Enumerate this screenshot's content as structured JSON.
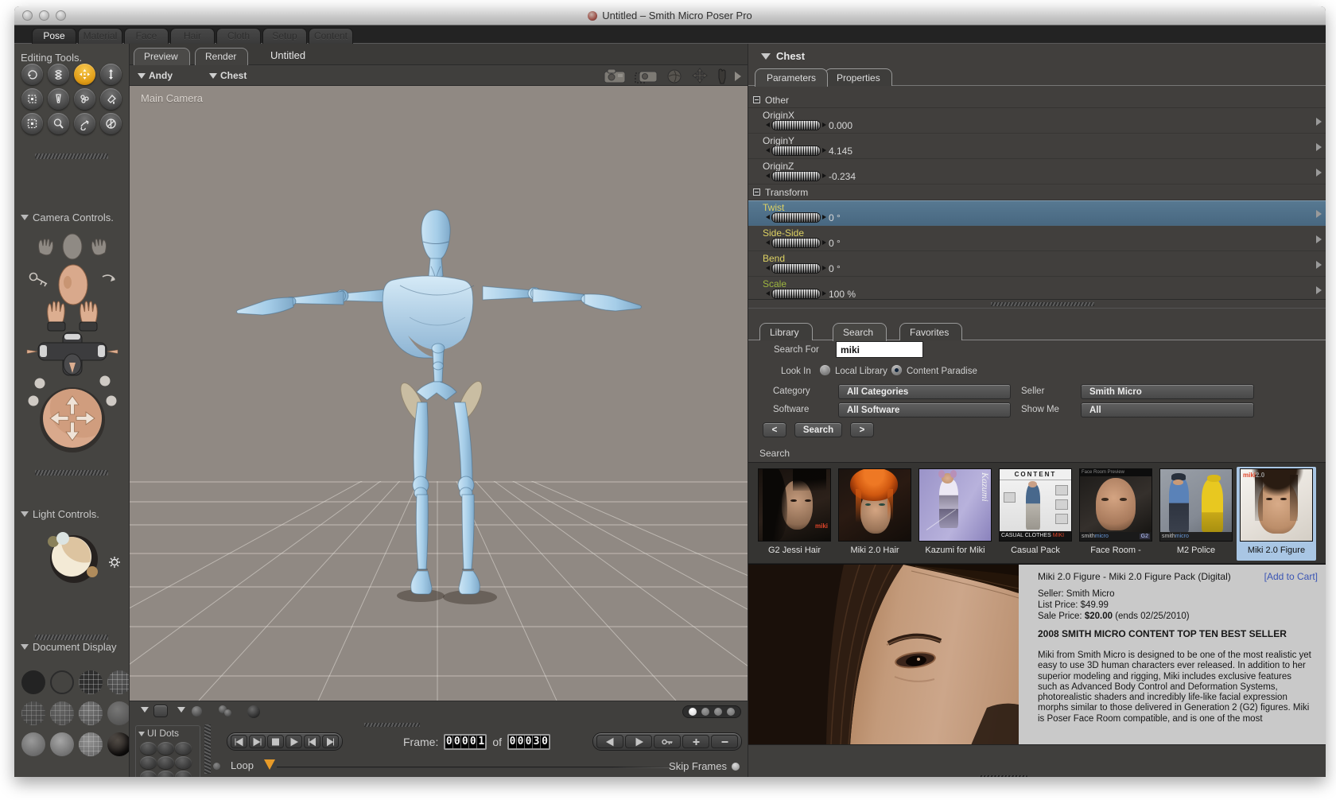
{
  "colors": {
    "accent_orange": "#e8a21f",
    "selection_blue": "#587c96",
    "thumb_selection": "#a9c6e4",
    "viewport_bg": "#908983"
  },
  "window": {
    "title": "Untitled – Smith Micro Poser Pro"
  },
  "main_tabs": {
    "items": [
      "Pose",
      "Material",
      "Face",
      "Hair",
      "Cloth",
      "Setup",
      "Content"
    ],
    "active": "Pose"
  },
  "sidebar": {
    "editing_tools": {
      "label": "Editing Tools.",
      "tools": [
        {
          "name": "rotate",
          "active": false
        },
        {
          "name": "twist",
          "active": false
        },
        {
          "name": "translate",
          "active": true
        },
        {
          "name": "translate-in-out",
          "active": false
        },
        {
          "name": "scale",
          "active": false
        },
        {
          "name": "taper",
          "active": false
        },
        {
          "name": "morph",
          "active": false
        },
        {
          "name": "color",
          "active": false
        },
        {
          "name": "grouping",
          "active": false
        },
        {
          "name": "view-magnifier",
          "active": false
        },
        {
          "name": "direct-manipulation",
          "active": false
        },
        {
          "name": "chain-break",
          "active": false
        }
      ]
    },
    "camera_controls": {
      "label": "Camera Controls."
    },
    "light_controls": {
      "label": "Light Controls."
    },
    "document_display": {
      "label": "Document Display",
      "styles": [
        "silhouette",
        "outline",
        "wireframe-dark",
        "wireframe",
        "hidden-line",
        "lit-wireframe",
        "wireframe-shaded",
        "flat-shaded",
        "flat-lined",
        "smooth-shaded",
        "smooth-lined",
        "texture-shaded"
      ]
    },
    "ui_dots": {
      "label": "UI Dots"
    }
  },
  "document": {
    "tabs": [
      "Preview",
      "Render"
    ],
    "active_tab": "Preview",
    "name": "Untitled",
    "actor_menu": "Andy",
    "part_menu": "Chest",
    "camera_label": "Main Camera"
  },
  "timeline": {
    "frame_label": "Frame:",
    "current_frame": "00001",
    "of_label": "of",
    "total_frames": "00030",
    "loop_label": "Loop",
    "skip_frames_label": "Skip Frames"
  },
  "parameters_panel": {
    "title": "Chest",
    "tabs": [
      "Parameters",
      "Properties"
    ],
    "active_tab": "Parameters",
    "groups": [
      {
        "name": "Other",
        "params": [
          {
            "label": "OriginX",
            "value": "0.000",
            "color": "white",
            "selected": false
          },
          {
            "label": "OriginY",
            "value": "4.145",
            "color": "white",
            "selected": false
          },
          {
            "label": "OriginZ",
            "value": "-0.234",
            "color": "white",
            "selected": false
          }
        ]
      },
      {
        "name": "Transform",
        "params": [
          {
            "label": "Twist",
            "value": "0 °",
            "color": "yellow",
            "selected": true
          },
          {
            "label": "Side-Side",
            "value": "0 °",
            "color": "yellow",
            "selected": false
          },
          {
            "label": "Bend",
            "value": "0 °",
            "color": "yellow",
            "selected": false
          },
          {
            "label": "Scale",
            "value": "100 %",
            "color": "green",
            "selected": false
          }
        ]
      }
    ]
  },
  "library_panel": {
    "tabs": [
      "Library",
      "Search",
      "Favorites"
    ],
    "active_tab": "Search",
    "search_for_label": "Search For",
    "search_value": "miki",
    "look_in_label": "Look In",
    "radios": [
      {
        "label": "Local Library",
        "selected": false
      },
      {
        "label": "Content Paradise",
        "selected": true
      }
    ],
    "category_label": "Category",
    "category_value": "All Categories",
    "seller_label": "Seller",
    "seller_value": "Smith Micro",
    "software_label": "Software",
    "software_value": "All Software",
    "show_me_label": "Show Me",
    "show_me_value": "All",
    "prev_label": "<",
    "search_button_label": "Search",
    "next_label": ">",
    "results_label": "Search",
    "thumbnails": [
      {
        "label": "G2 Jessi Hair",
        "selected": false,
        "style": "jessi"
      },
      {
        "label": "Miki 2.0 Hair",
        "selected": false,
        "style": "mikihair"
      },
      {
        "label": "Kazumi for Miki",
        "selected": false,
        "style": "kazumi"
      },
      {
        "label": "Casual Pack",
        "selected": false,
        "style": "casual"
      },
      {
        "label": "Face Room -",
        "selected": false,
        "style": "faceroom"
      },
      {
        "label": "M2 Police",
        "selected": false,
        "style": "police"
      },
      {
        "label": "Miki 2.0 Figure",
        "selected": true,
        "style": "mikifig"
      }
    ]
  },
  "product_detail": {
    "title": "Miki 2.0 Figure - Miki 2.0 Figure Pack (Digital)",
    "add_to_cart": "[Add to Cart]",
    "seller": "Seller: Smith Micro",
    "list_price": "List Price: $49.99",
    "sale_price_label": "Sale Price:",
    "sale_price": "$20.00",
    "sale_ends": "(ends 02/25/2010)",
    "headline": "2008 SMITH MICRO CONTENT TOP TEN BEST SELLER",
    "description": "Miki from Smith Micro is designed to be one of the most realistic yet easy to use 3D human characters ever released. In addition to her superior modeling and rigging, Miki includes exclusive features such as Advanced Body Control and Deformation Systems, photorealistic shaders and incredibly life-like facial expression morphs similar to those delivered in Generation 2 (G2) figures. Miki is Poser Face Room compatible, and is one of the most"
  }
}
